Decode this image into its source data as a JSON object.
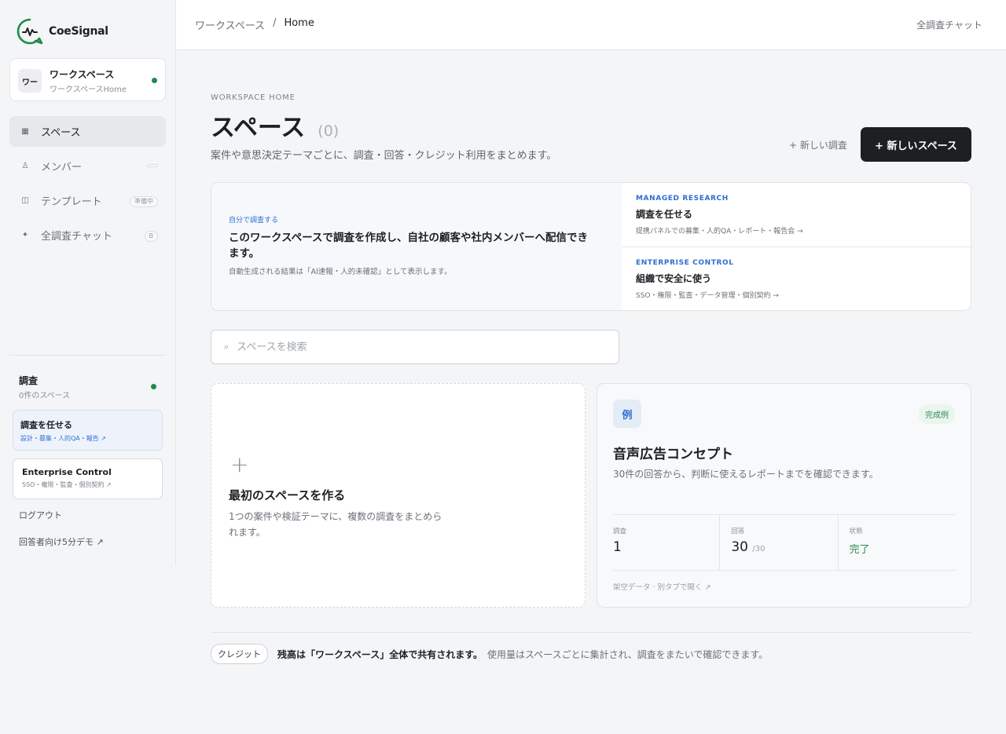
{
  "app": {
    "brand": "CoeSignal",
    "logo_icon": "speech-bubble-wave-icon",
    "brand_color": "#1f8a4c"
  },
  "workspace": {
    "avatar_text": "ワー",
    "name": "ワークスペース",
    "subtitle": "ワークスペースHome"
  },
  "sidebar": {
    "items": [
      {
        "label": "スペース",
        "icon": "grid-icon",
        "active": true,
        "badge": ""
      },
      {
        "label": "メンバー",
        "icon": "person-icon",
        "active": false,
        "badge": ""
      },
      {
        "label": "テンプレート",
        "icon": "template-icon",
        "active": false,
        "badge": "準備中"
      },
      {
        "label": "全調査チャット",
        "icon": "sparkle-icon",
        "active": false,
        "badge": "B"
      }
    ],
    "research_title": "調査",
    "research_sub": "0件のスペース",
    "managed_card": {
      "title": "調査を任せる",
      "sub": "設計・募集・人的QA・報告 ↗"
    },
    "enterprise_card": {
      "title": "Enterprise Control",
      "sub": "SSO・権限・監査・個別契約 ↗"
    },
    "logout": "ログアウト",
    "demo_link": "回答者向け5分デモ ↗"
  },
  "topbar": {
    "breadcrumb_root": "ワークスペース",
    "breadcrumb_sep": "/",
    "breadcrumb_current": "Home",
    "right_link": "全調査チャット"
  },
  "main": {
    "eyebrow": "WORKSPACE HOME",
    "title": "スペース",
    "count": "(0)",
    "description": "案件や意思決定テーマごとに、調査・回答・クレジット利用をまとめます。",
    "new_survey_label": "+ 新しい調査",
    "new_space_label": "+ 新しいスペース"
  },
  "promo": {
    "left_eyebrow": "自分で調査する",
    "left_title": "このワークスペースで調査を作成し、自社の顧客や社内メンバーへ配信できます。",
    "left_note": "自動生成される結果は「AI速報・人的未確認」として表示します。",
    "managed": {
      "eyebrow": "MANAGED RESEARCH",
      "title": "調査を任せる",
      "sub": "提携パネルでの募集・人的QA・レポート・報告会 →"
    },
    "enterprise": {
      "eyebrow": "ENTERPRISE CONTROL",
      "title": "組織で安全に使う",
      "sub": "SSO・権限・監査・データ管理・個別契約 →"
    }
  },
  "search": {
    "placeholder": "スペースを検索",
    "value": ""
  },
  "create_card": {
    "title": "最初のスペースを作る",
    "description": "1つの案件や検証テーマに、複数の調査をまとめられます。"
  },
  "example_card": {
    "badge": "例",
    "status": "完成例",
    "title": "音声広告コンセプト",
    "description": "30件の回答から、判断に使えるレポートまでを確認できます。",
    "stats": {
      "surveys_label": "調査",
      "surveys_value": "1",
      "responses_label": "回答",
      "responses_value": "30",
      "responses_total": "/30",
      "status_label": "状態",
      "status_value": "完了"
    },
    "footer": "架空データ · 別タブで開く ↗"
  },
  "credits": {
    "pill": "クレジット",
    "strong": "残高は「ワークスペース」全体で共有されます。",
    "soft": "使用量はスペースごとに集計され、調査をまたいで確認できます。"
  }
}
